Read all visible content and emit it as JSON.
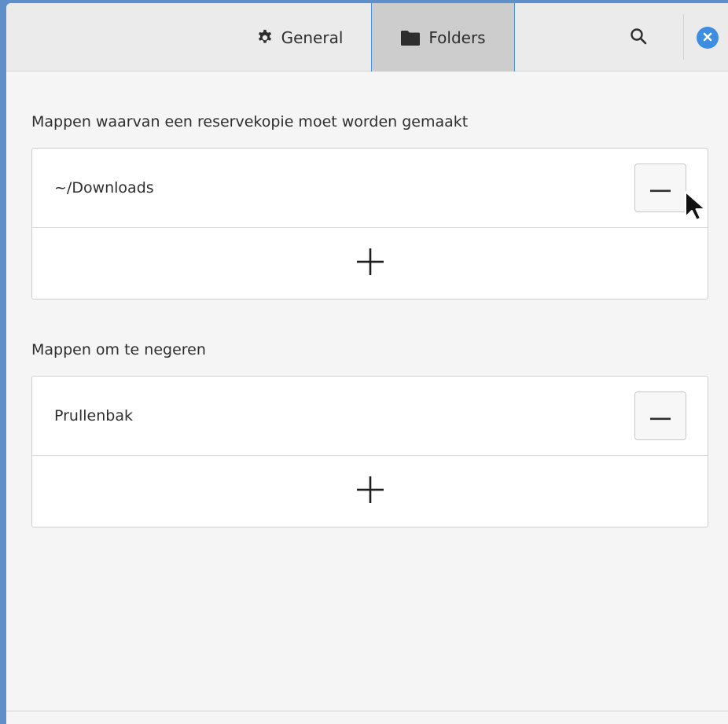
{
  "header": {
    "tabs": [
      {
        "label": "General",
        "icon": "gear-icon",
        "active": false
      },
      {
        "label": "Folders",
        "icon": "folder-icon",
        "active": true
      }
    ],
    "search_icon": "search-icon",
    "close_icon": "close-icon"
  },
  "backup_section": {
    "title": "Mappen waarvan een reservekopie moet worden gemaakt",
    "items": [
      {
        "label": "~/Downloads"
      }
    ],
    "remove_symbol": "−",
    "add_symbol": "+"
  },
  "ignore_section": {
    "title": "Mappen om te negeren",
    "items": [
      {
        "label": "Prullenbak"
      }
    ],
    "remove_symbol": "−",
    "add_symbol": "+"
  },
  "colors": {
    "accent": "#4a90d9",
    "close_button": "#3d8ee0",
    "active_tab_bg": "#cdcdcd",
    "desktop_bg": "#5f8fc9"
  }
}
